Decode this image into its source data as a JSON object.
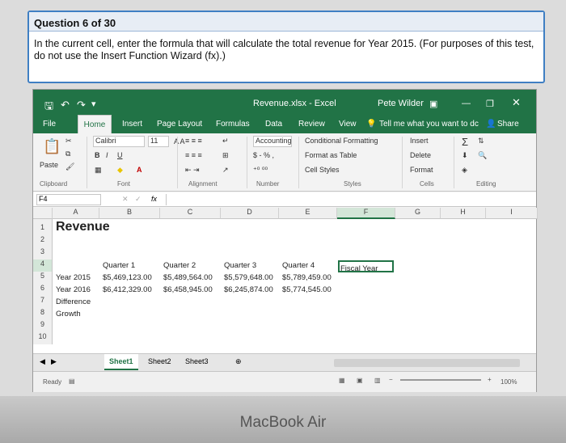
{
  "question": {
    "header": "Question 6 of 30",
    "text": "In the current cell, enter the formula that will calculate the total revenue for Year 2015. (For purposes of this test, do not use the Insert Function Wizard (fx).)"
  },
  "excel": {
    "title": "Revenue.xlsx - Excel",
    "user": "Pete Wilder",
    "tabs": [
      "File",
      "Home",
      "Insert",
      "Page Layout",
      "Formulas",
      "Data",
      "Review",
      "View"
    ],
    "tell_me": "Tell me what you want to dc",
    "share": "Share",
    "ribbon": {
      "paste": "Paste",
      "font_name": "Calibri",
      "font_size": "11",
      "bold": "B",
      "italic": "I",
      "underline": "U",
      "number_format": "Accounting",
      "currency": "$ - % ,",
      "conditional": "Conditional Formatting",
      "format_table": "Format as Table",
      "cell_styles": "Cell Styles",
      "insert": "Insert",
      "delete": "Delete",
      "format": "Format",
      "groups": [
        "Clipboard",
        "Font",
        "Alignment",
        "Number",
        "Styles",
        "Cells",
        "Editing"
      ]
    },
    "name_box": "F4",
    "fx": "fx",
    "columns": [
      "A",
      "B",
      "C",
      "D",
      "E",
      "F",
      "G",
      "H",
      "I"
    ],
    "rows": [
      "1",
      "2",
      "3",
      "4",
      "5",
      "6",
      "7",
      "8",
      "9",
      "10"
    ],
    "cells": {
      "title": "Revenue",
      "headers": [
        "Quarter 1",
        "Quarter 2",
        "Quarter 3",
        "Quarter 4",
        "Fiscal Year"
      ],
      "year2015": [
        "Year 2015",
        "$5,469,123.00",
        "$5,489,564.00",
        "$5,579,648.00",
        "$5,789,459.00"
      ],
      "year2016": [
        "Year 2016",
        "$6,412,329.00",
        "$6,458,945.00",
        "$6,245,874.00",
        "$5,774,545.00"
      ],
      "difference": "Difference",
      "growth": "Growth"
    },
    "sheets": [
      "Sheet1",
      "Sheet2",
      "Sheet3"
    ],
    "status": "Ready",
    "zoom": "100%"
  },
  "laptop_label": "MacBook Air"
}
